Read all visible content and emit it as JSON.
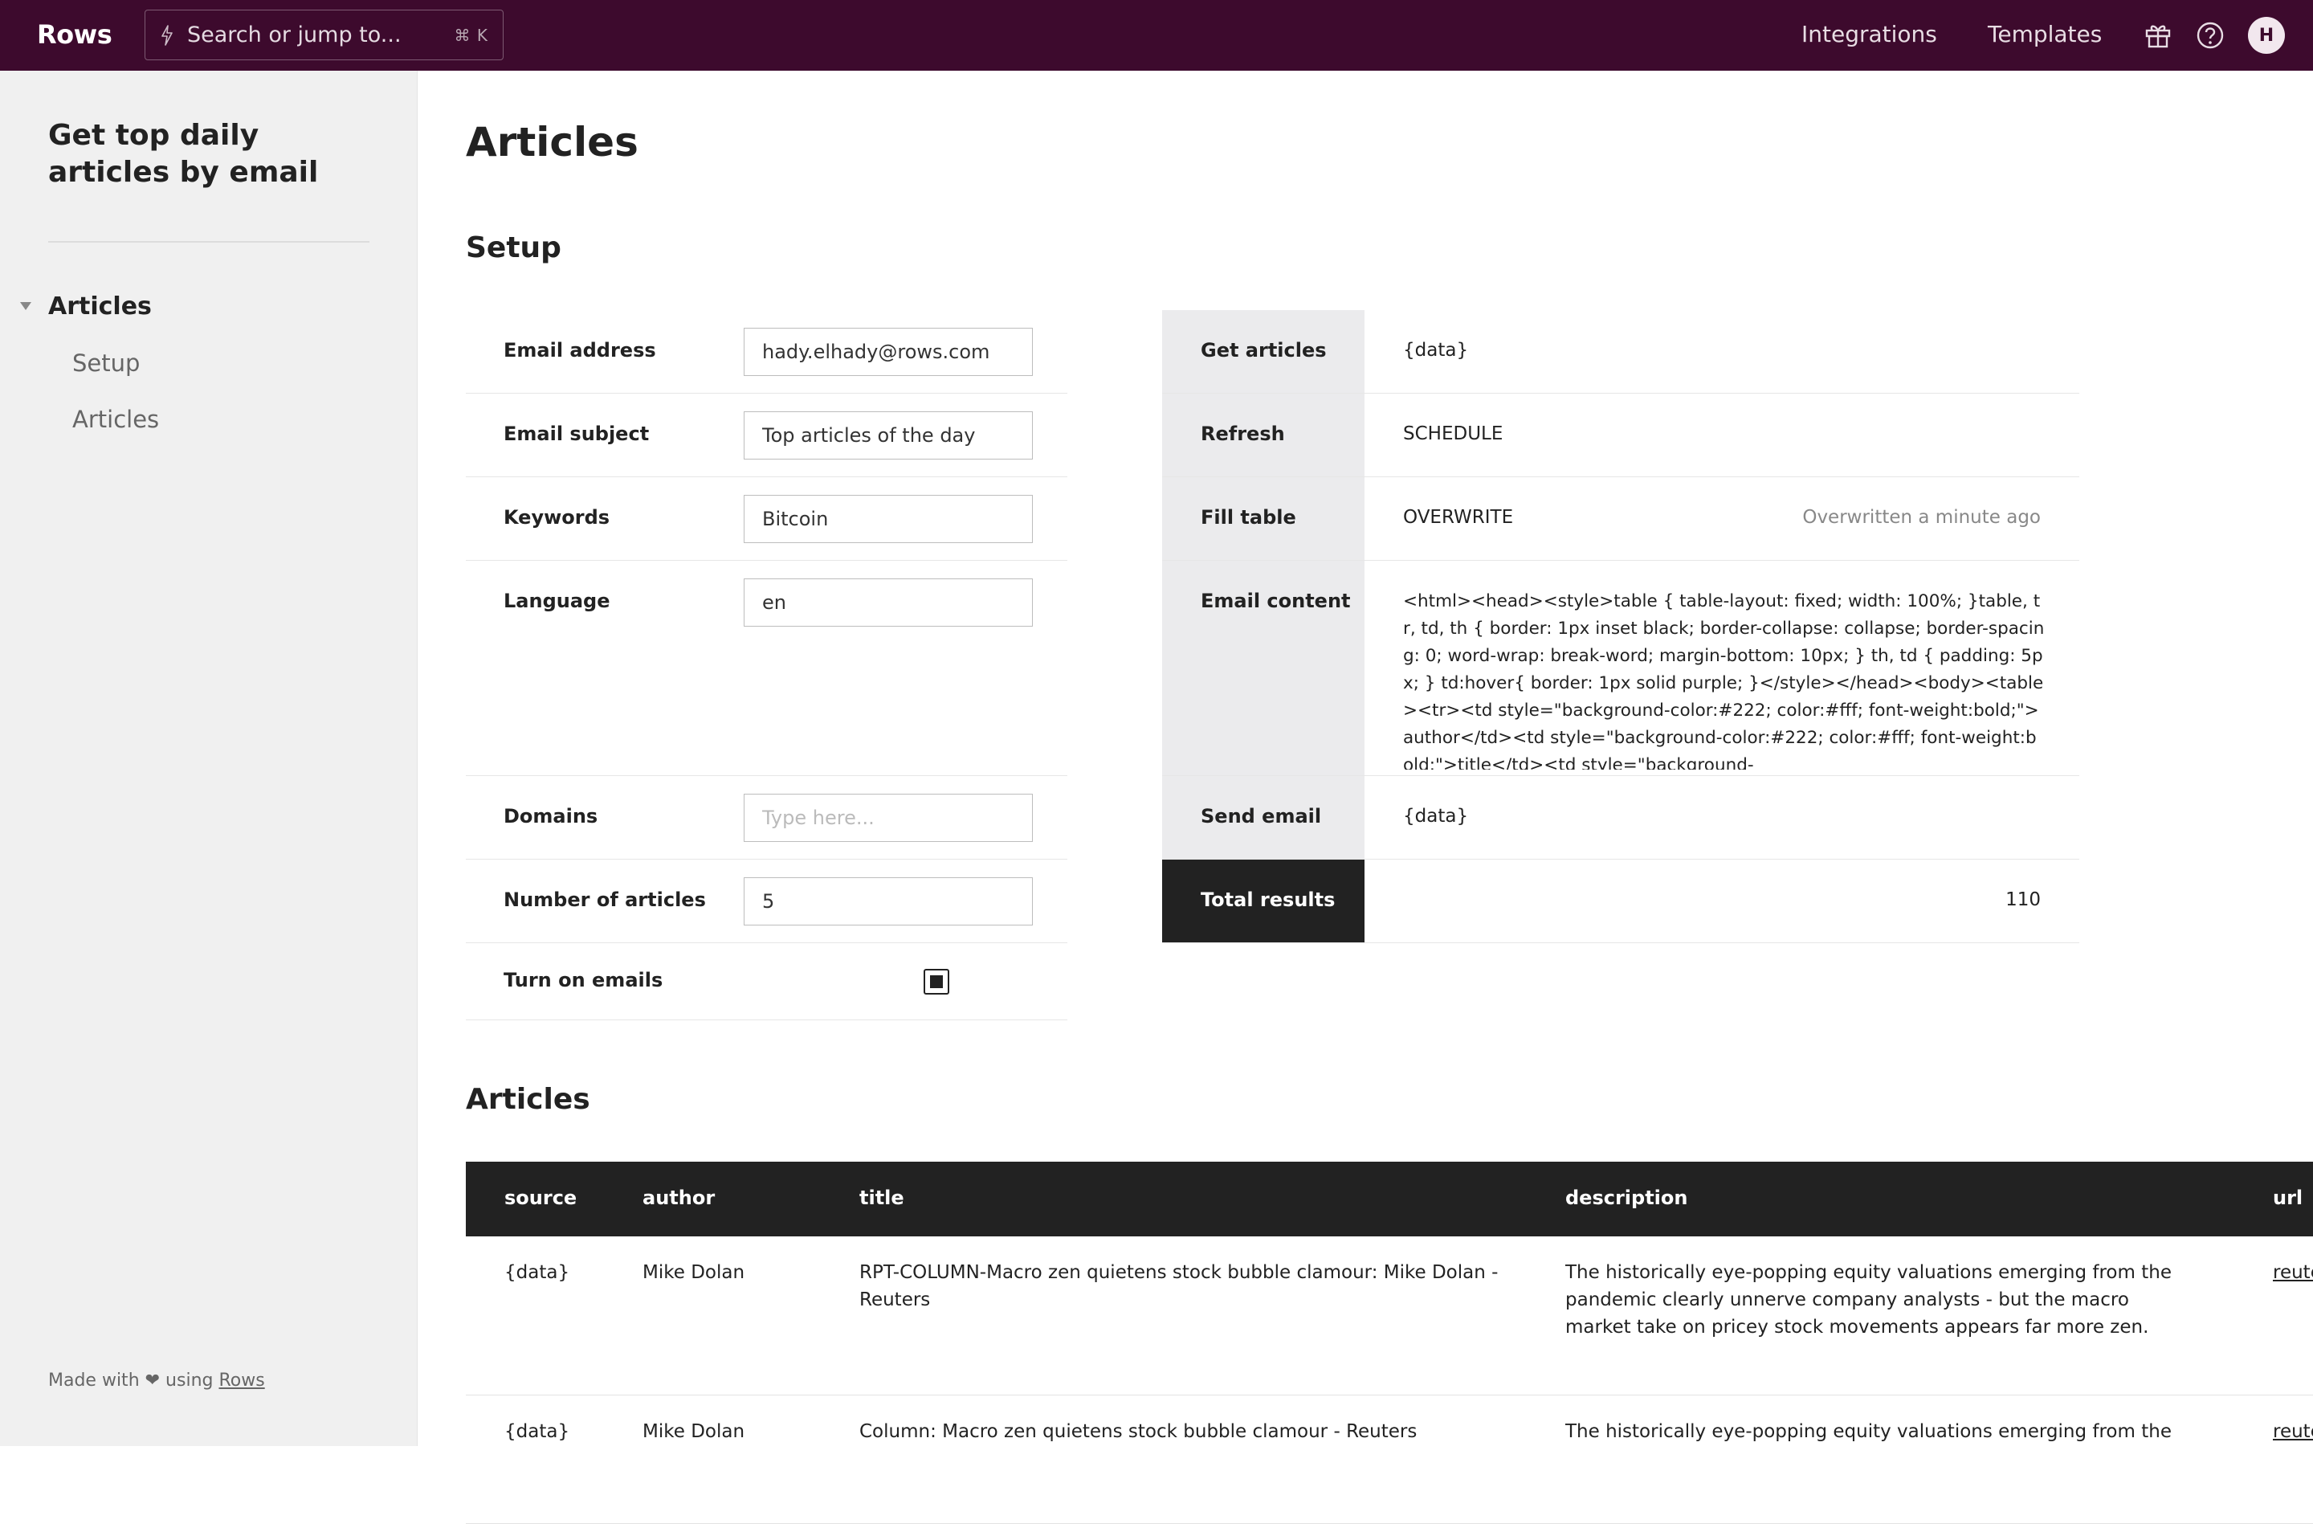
{
  "topbar": {
    "brand": "Rows",
    "search_placeholder": "Search or jump to...",
    "search_shortcut": "⌘ K",
    "nav": [
      "Integrations",
      "Templates"
    ],
    "avatar_initial": "H",
    "bg_color": "#3d0a2d"
  },
  "sidebar": {
    "title": "Get top daily articles by email",
    "section": "Articles",
    "items": [
      "Setup",
      "Articles"
    ],
    "footer_prefix": "Made with ❤ using",
    "footer_link": "Rows"
  },
  "main": {
    "page_title": "Articles",
    "setup_heading": "Setup",
    "articles_heading": "Articles"
  },
  "setup": {
    "email_address": {
      "label": "Email address",
      "value": "hady.elhady@rows.com"
    },
    "email_subject": {
      "label": "Email subject",
      "value": "Top articles of the day"
    },
    "keywords": {
      "label": "Keywords",
      "value": "Bitcoin"
    },
    "language": {
      "label": "Language",
      "value": "en"
    },
    "domains": {
      "label": "Domains",
      "value": "",
      "placeholder": "Type here..."
    },
    "number_of_articles": {
      "label": "Number of articles",
      "value": "5"
    },
    "turn_on_emails": {
      "label": "Turn on emails",
      "checked": true
    }
  },
  "actions": {
    "get_articles": {
      "label": "Get articles",
      "value": "{data}"
    },
    "refresh": {
      "label": "Refresh",
      "value": "SCHEDULE"
    },
    "fill_table": {
      "label": "Fill table",
      "value": "OVERWRITE",
      "meta": "Overwritten a minute ago"
    },
    "email_content": {
      "label": "Email content",
      "value": "<html><head><style>table { table-layout: fixed; width: 100%; }table, tr, td, th { border: 1px inset black; border-collapse: collapse; border-spacing: 0; word-wrap: break-word; margin-bottom: 10px; } th, td { padding: 5px; } td:hover{ border: 1px solid purple; }</style></head><body><table><tr><td style=\"background-color:#222; color:#fff; font-weight:bold;\">author</td><td style=\"background-color:#222; color:#fff; font-weight:bold;\">title</td><td style=\"background-"
    },
    "send_email": {
      "label": "Send email",
      "value": "{data}"
    },
    "total_results": {
      "label": "Total results",
      "value": "110"
    }
  },
  "articles_table": {
    "columns": [
      "source",
      "author",
      "title",
      "description",
      "url"
    ],
    "rows": [
      {
        "source": "{data}",
        "author": "Mike Dolan",
        "title": "RPT-COLUMN-Macro zen quietens stock bubble clamour: Mike Dolan - Reuters",
        "description": "The historically eye-popping equity valuations emerging from the pandemic clearly unnerve company analysts - but the macro market take on pricey stock movements appears far more zen.",
        "url": "reute"
      },
      {
        "source": "{data}",
        "author": "Mike Dolan",
        "title": "Column: Macro zen quietens stock bubble clamour - Reuters",
        "description": "The historically eye-popping equity valuations emerging from the",
        "url": "reute"
      }
    ]
  }
}
